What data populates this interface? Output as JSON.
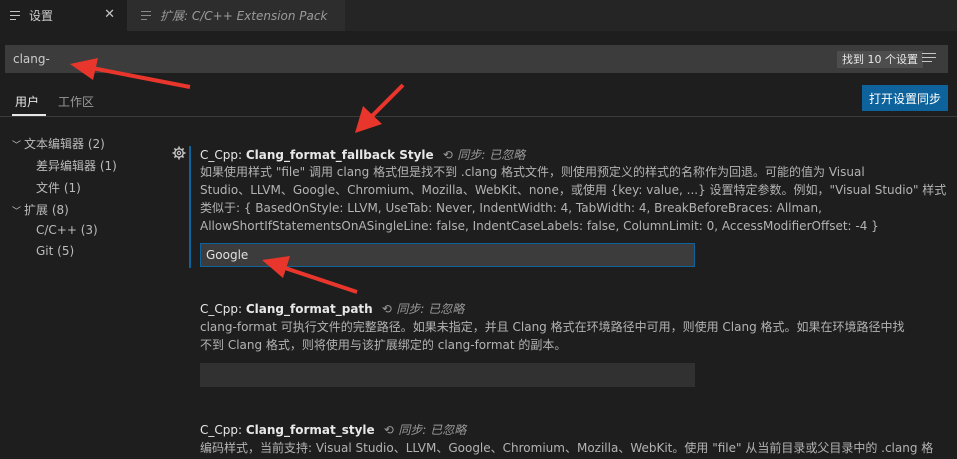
{
  "tabs": [
    {
      "label": "设置",
      "icon": "settings-file-icon",
      "close": "✕"
    },
    {
      "label": "扩展: C/C++ Extension Pack",
      "icon": "extension-file-icon"
    }
  ],
  "search": {
    "value": "clang-",
    "result_count": "找到 10 个设置"
  },
  "scopes": {
    "user": "用户",
    "workspace": "工作区",
    "sync_button": "打开设置同步"
  },
  "toc": [
    {
      "label": "文本编辑器 (2)",
      "expanded": true
    },
    {
      "label": "差异编辑器 (1)"
    },
    {
      "label": "文件 (1)"
    },
    {
      "label": "扩展 (8)",
      "expanded": true
    },
    {
      "label": "C/C++ (3)"
    },
    {
      "label": "Git (5)"
    }
  ],
  "settings": [
    {
      "prefix": "C_Cpp: ",
      "name": "Clang_format_fallback Style",
      "sync": "同步: 已忽略",
      "desc_lines": [
        "如果使用样式 \"file\" 调用 clang 格式但是找不到 .clang 格式文件，则使用预定义的样式的名称作为回退。可能的值为 Visual",
        "Studio、LLVM、Google、Chromium、Mozilla、WebKit、none，或使用 {key: value, ...} 设置特定参数。例如，\"Visual Studio\" 样式",
        "类似于: { BasedOnStyle: LLVM, UseTab: Never, IndentWidth: 4, TabWidth: 4, BreakBeforeBraces: Allman,",
        "AllowShortIfStatementsOnASingleLine: false, IndentCaseLabels: false, ColumnLimit: 0, AccessModifierOffset: -4 }"
      ],
      "value": "Google"
    },
    {
      "prefix": "C_Cpp: ",
      "name": "Clang_format_path",
      "sync": "同步: 已忽略",
      "desc_lines": [
        "clang-format 可执行文件的完整路径。如果未指定，并且 Clang 格式在环境路径中可用，则使用 Clang 格式。如果在环境路径中找",
        "不到 Clang 格式，则将使用与该扩展绑定的 clang-format 的副本。"
      ],
      "value": ""
    },
    {
      "prefix": "C_Cpp: ",
      "name": "Clang_format_style",
      "sync": "同步: 已忽略",
      "desc_lines": [
        "编码样式，当前支持: Visual Studio、LLVM、Google、Chromium、Mozilla、WebKit。使用 \"file\" 从当前目录或父目录中的 .clang 格"
      ]
    }
  ],
  "colors": {
    "accent": "#0e639c",
    "arrow": "#e8362c",
    "background": "#1e1e1e"
  }
}
